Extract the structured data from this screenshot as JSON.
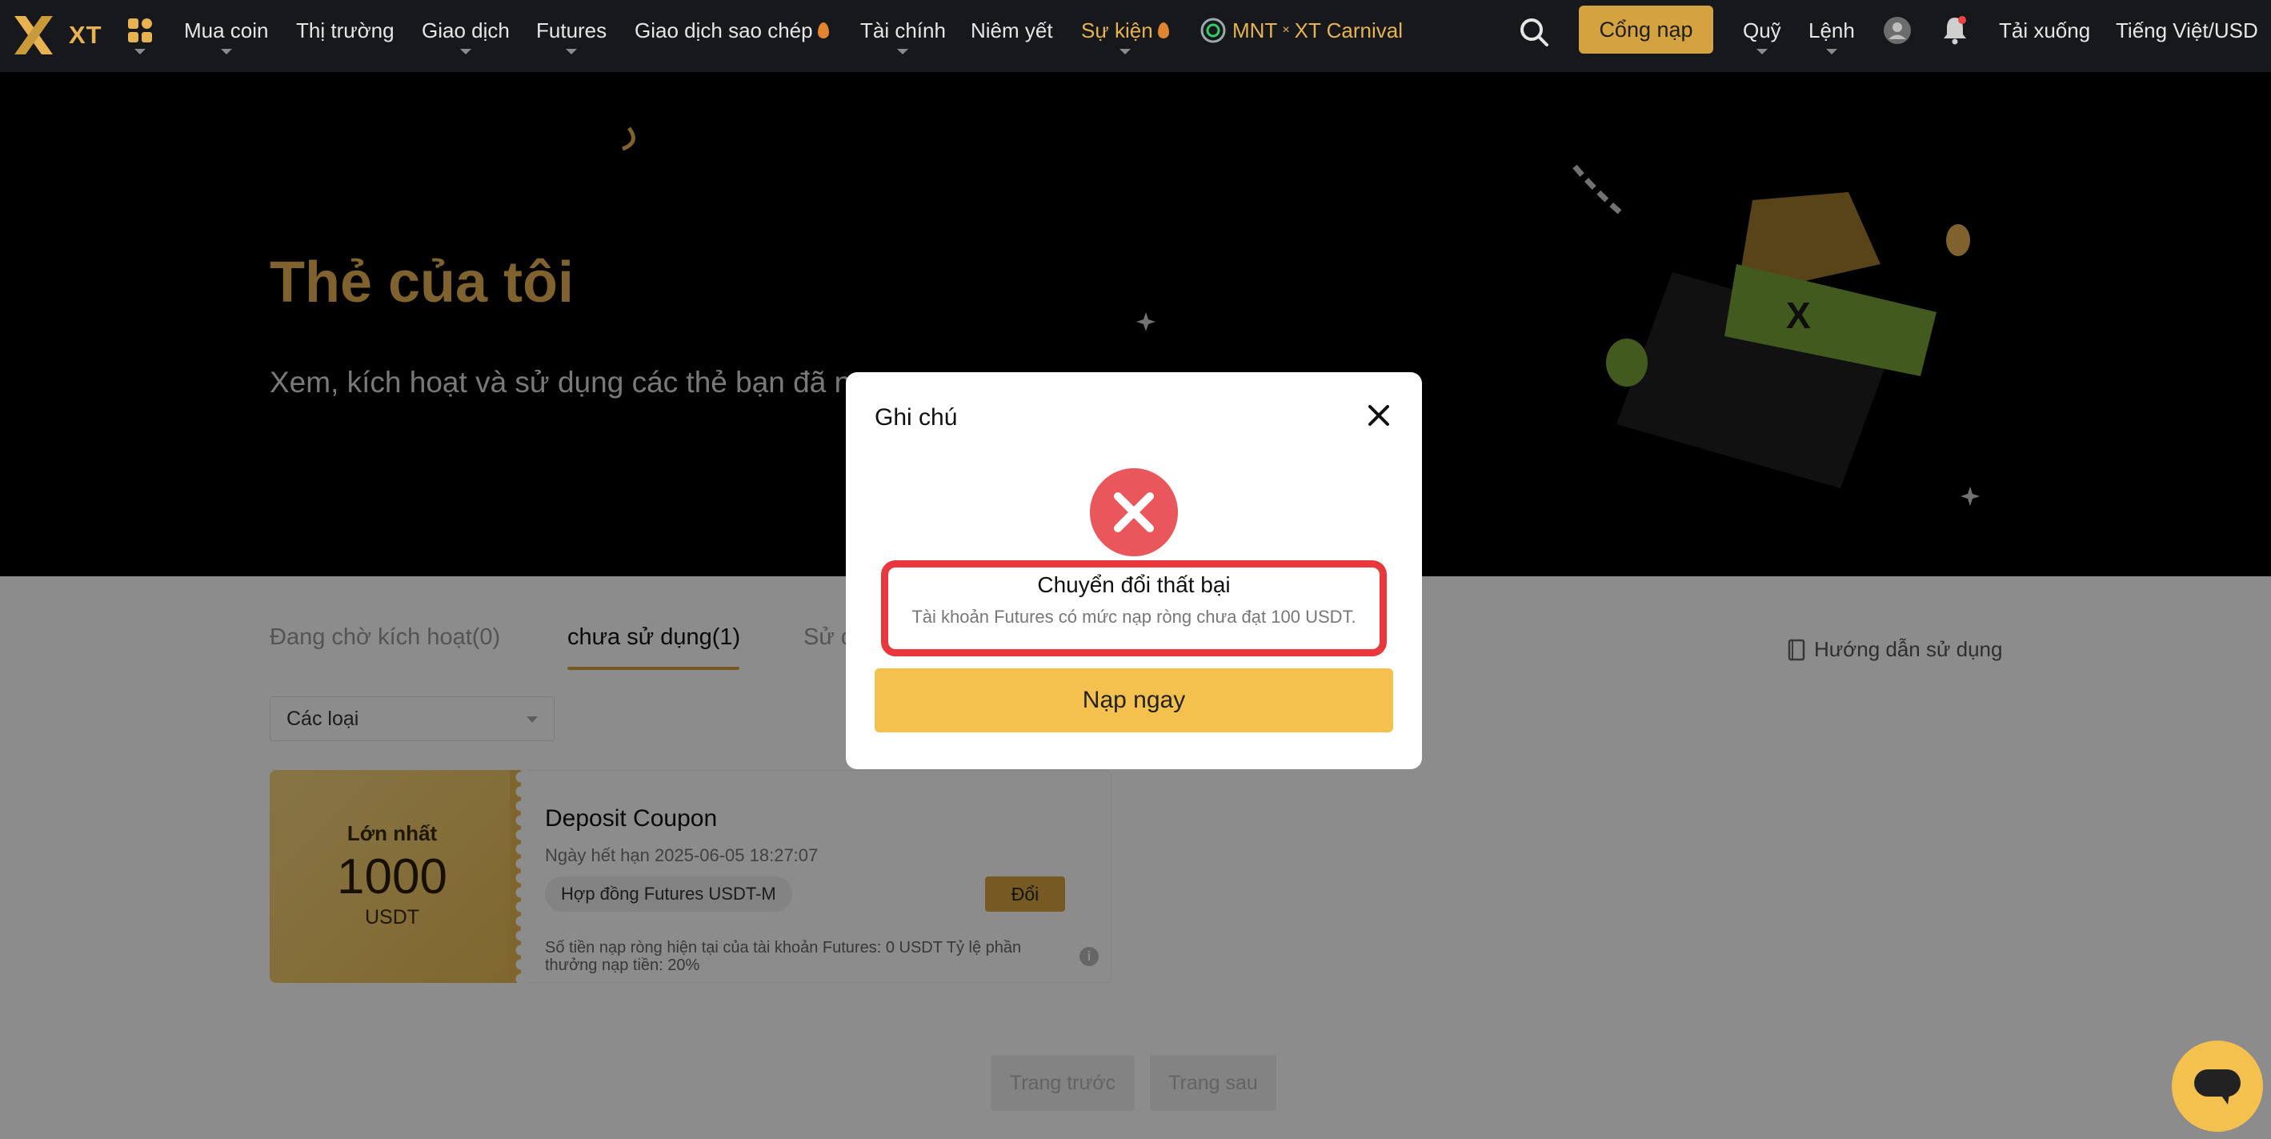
{
  "nav": {
    "logo_text": "XT",
    "items": [
      {
        "label": "Mua coin"
      },
      {
        "label": "Thị trường"
      },
      {
        "label": "Giao dịch"
      },
      {
        "label": "Futures"
      },
      {
        "label": "Giao dịch sao chép"
      },
      {
        "label": "Tài chính"
      },
      {
        "label": "Niêm yết"
      },
      {
        "label": "Sự kiện"
      }
    ],
    "carnival": {
      "left": "MNT",
      "sep": "×",
      "right": "XT Carnival"
    },
    "deposit_label": "Cổng nạp",
    "right_items": {
      "fund": "Quỹ",
      "orders": "Lệnh",
      "download": "Tải xuống",
      "language": "Tiếng Việt/USD"
    },
    "icons": [
      "apps-icon",
      "search-icon",
      "avatar-icon",
      "bell-icon"
    ]
  },
  "hero": {
    "title": "Thẻ của tôi",
    "subtitle": "Xem, kích hoạt và sử dụng các thẻ bạn đã n"
  },
  "tabs": [
    {
      "label": "Đang chờ kích hoạt(0)"
    },
    {
      "label": "chưa sử dụng(1)",
      "active": true
    },
    {
      "label": "Sử d"
    }
  ],
  "guide_label": "Hướng dẫn sử dụng",
  "filter": {
    "value": "Các loại"
  },
  "coupon": {
    "max_label": "Lớn nhất",
    "amount": "1000",
    "unit": "USDT",
    "title": "Deposit Coupon",
    "expiry": "Ngày hết hạn 2025-06-05 18:27:07",
    "tag": "Hợp đồng Futures USDT-M",
    "redeem_label": "Đổi",
    "info": "Số tiền nạp ròng hiện tại của tài khoản Futures:  0 USDT   Tỷ lệ phần thưởng nạp tiền:  20%"
  },
  "pagination": {
    "prev": "Trang trước",
    "next": "Trang sau"
  },
  "modal": {
    "title": "Ghi chú",
    "status_title": "Chuyển đổi thất bại",
    "message": "Tài khoản Futures có mức nạp ròng chưa đạt 100 USDT.",
    "cta": "Nạp ngay"
  },
  "colors": {
    "gold": "#e7b352",
    "cta": "#f4c14f",
    "error": "#e9575c",
    "highlight": "#e8383d",
    "nav_bg": "#17181c"
  }
}
